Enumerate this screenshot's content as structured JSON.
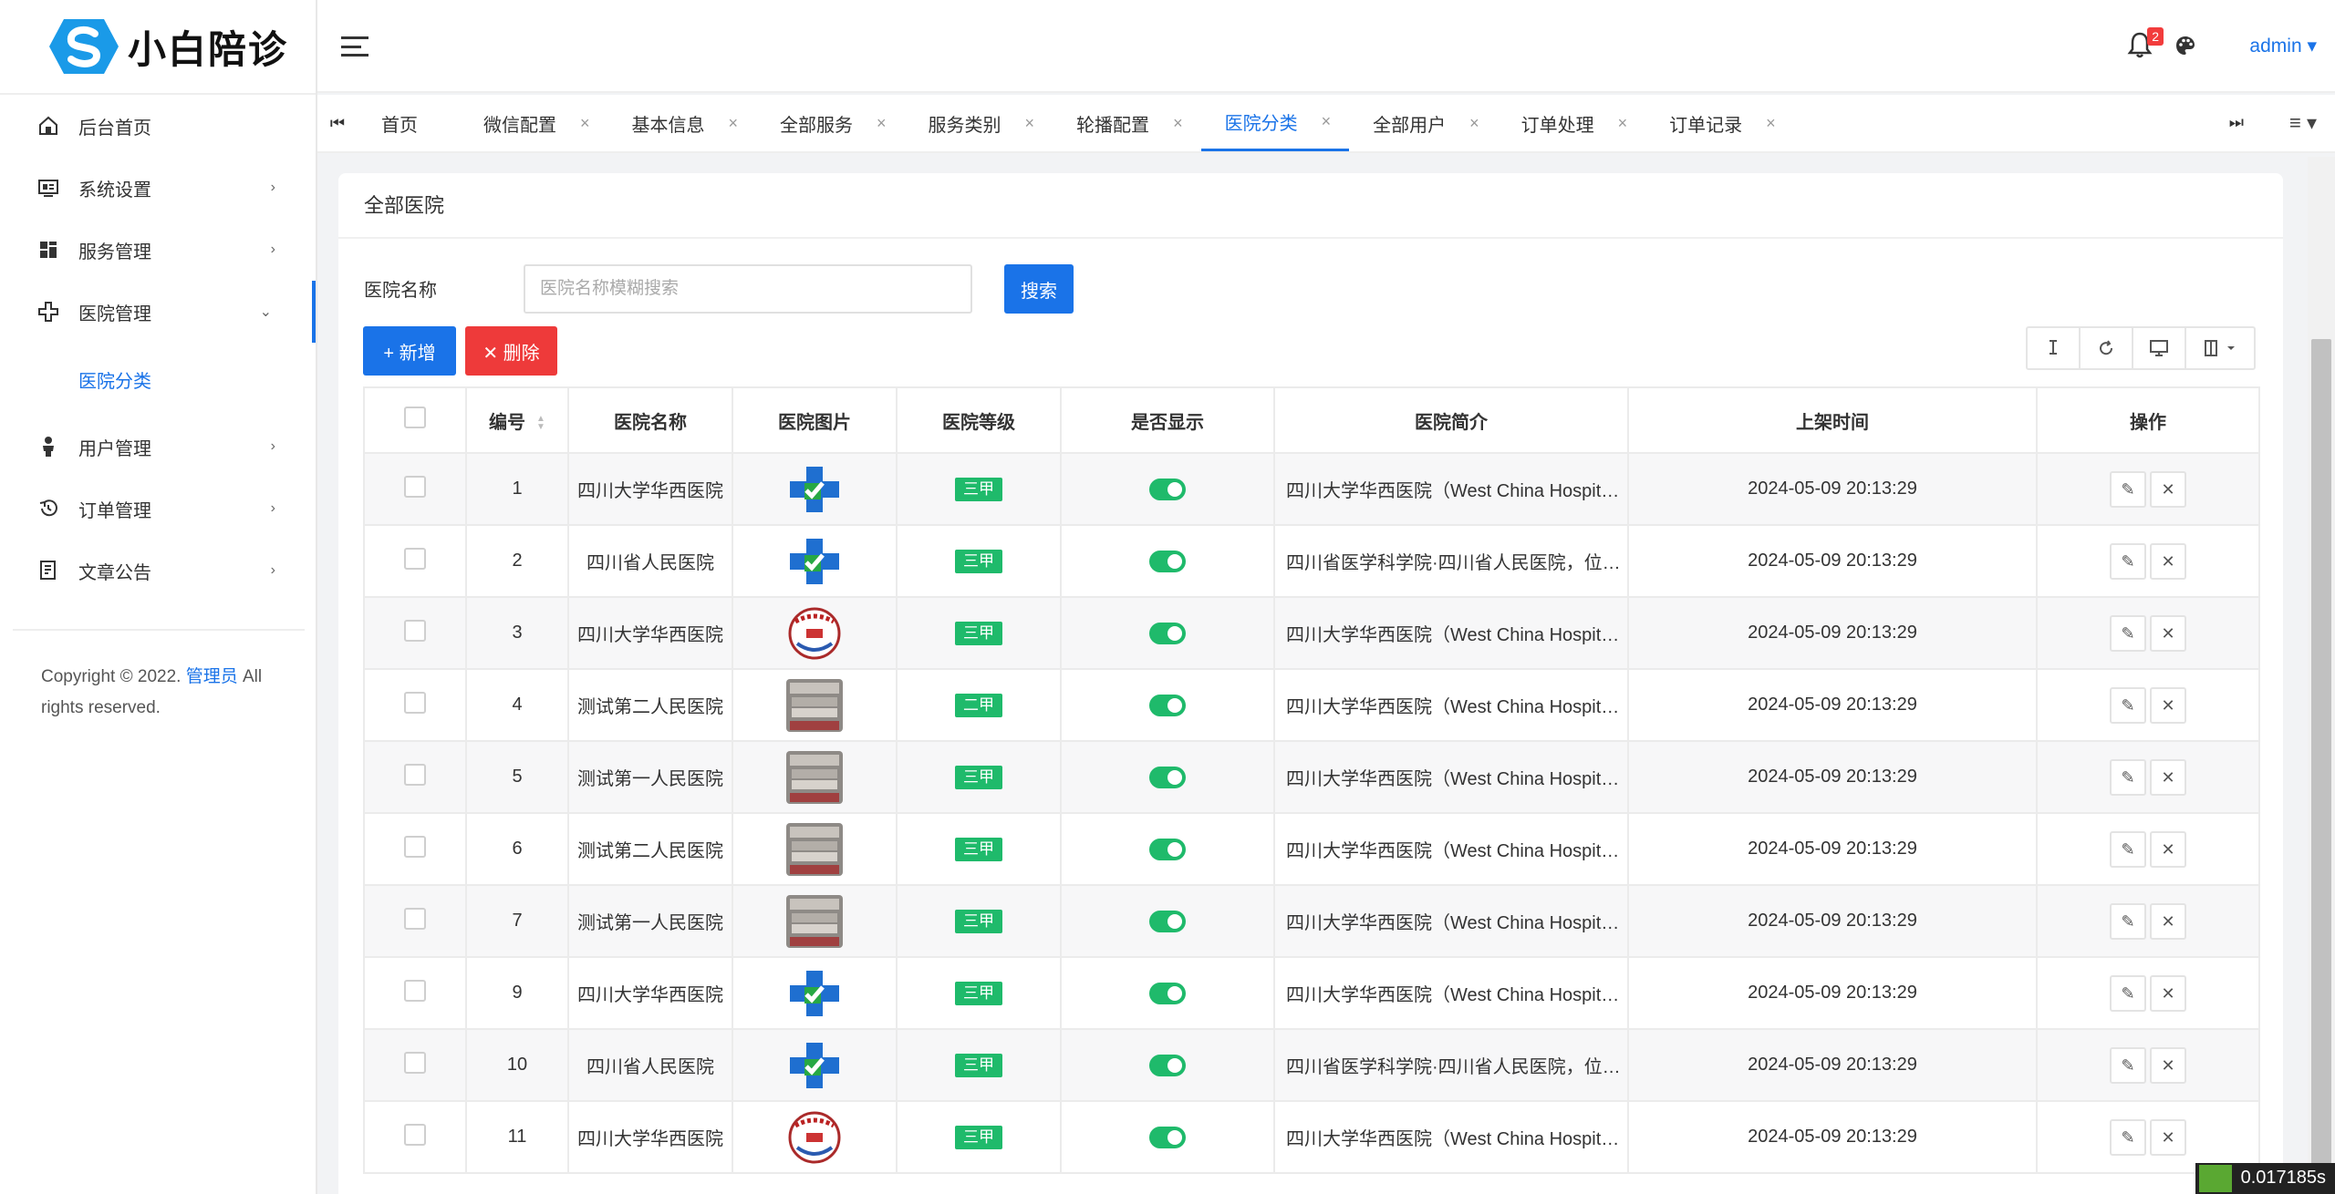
{
  "app": {
    "name": "小白陪诊"
  },
  "sidebar": {
    "items": [
      {
        "label": "后台首页",
        "icon": "home-icon",
        "arrow": ""
      },
      {
        "label": "系统设置",
        "icon": "settings-panel-icon",
        "arrow": "›"
      },
      {
        "label": "服务管理",
        "icon": "grid-icon",
        "arrow": "›"
      },
      {
        "label": "医院管理",
        "icon": "medical-cross-icon",
        "arrow": "⌄"
      },
      {
        "label": "用户管理",
        "icon": "user-icon",
        "arrow": "›"
      },
      {
        "label": "订单管理",
        "icon": "history-icon",
        "arrow": "›"
      },
      {
        "label": "文章公告",
        "icon": "document-icon",
        "arrow": "›"
      }
    ],
    "submenu": {
      "label": "医院分类"
    },
    "copyright": {
      "prefix": "Copyright © 2022. ",
      "link": "管理员",
      "suffix": " All rights reserved."
    }
  },
  "header": {
    "badge": "2",
    "user": "admin ▾"
  },
  "tabs": [
    {
      "label": "首页",
      "close": ""
    },
    {
      "label": "微信配置",
      "close": "×"
    },
    {
      "label": "基本信息",
      "close": "×"
    },
    {
      "label": "全部服务",
      "close": "×"
    },
    {
      "label": "服务类别",
      "close": "×"
    },
    {
      "label": "轮播配置",
      "close": "×"
    },
    {
      "label": "医院分类",
      "close": "×"
    },
    {
      "label": "全部用户",
      "close": "×"
    },
    {
      "label": "订单处理",
      "close": "×"
    },
    {
      "label": "订单记录",
      "close": "×"
    }
  ],
  "active_tab": "医院分类",
  "card": {
    "title": "全部医院",
    "search_label": "医院名称",
    "search_placeholder": "医院名称模糊搜索",
    "search_button": "搜索",
    "add_button": "+ 新增",
    "delete_button": "✕ 删除"
  },
  "table": {
    "headers": [
      "编号",
      "医院名称",
      "医院图片",
      "医院等级",
      "是否显示",
      "医院简介",
      "上架时间",
      "操作"
    ],
    "rows": [
      {
        "id": "1",
        "name": "四川大学华西医院",
        "image": "cross-logo",
        "grade": "三甲",
        "intro": "四川大学华西医院（West China Hospital of Sichuan University）",
        "time": "2024-05-09 20:13:29"
      },
      {
        "id": "2",
        "name": "四川省人民医院",
        "image": "cross-logo",
        "grade": "三甲",
        "intro": "四川省医学科学院·四川省人民医院，位于成都市",
        "time": "2024-05-09 20:13:29"
      },
      {
        "id": "3",
        "name": "四川大学华西医院",
        "image": "round-seal",
        "grade": "三甲",
        "intro": "四川大学华西医院（West China Hospital of Sichuan University）",
        "time": "2024-05-09 20:13:29"
      },
      {
        "id": "4",
        "name": "测试第二人民医院",
        "image": "building-photo",
        "grade": "二甲",
        "intro": "四川大学华西医院（West China Hospital of Sichuan University）",
        "time": "2024-05-09 20:13:29"
      },
      {
        "id": "5",
        "name": "测试第一人民医院",
        "image": "building-photo",
        "grade": "三甲",
        "intro": "四川大学华西医院（West China Hospital of Sichuan University）",
        "time": "2024-05-09 20:13:29"
      },
      {
        "id": "6",
        "name": "测试第二人民医院",
        "image": "building-photo",
        "grade": "三甲",
        "intro": "四川大学华西医院（West China Hospital of Sichuan University）",
        "time": "2024-05-09 20:13:29"
      },
      {
        "id": "7",
        "name": "测试第一人民医院",
        "image": "building-photo",
        "grade": "三甲",
        "intro": "四川大学华西医院（West China Hospital of Sichuan University）",
        "time": "2024-05-09 20:13:29"
      },
      {
        "id": "9",
        "name": "四川大学华西医院",
        "image": "cross-logo",
        "grade": "三甲",
        "intro": "四川大学华西医院（West China Hospital of Sichuan University）",
        "time": "2024-05-09 20:13:29"
      },
      {
        "id": "10",
        "name": "四川省人民医院",
        "image": "cross-logo",
        "grade": "三甲",
        "intro": "四川省医学科学院·四川省人民医院，位于成都市",
        "time": "2024-05-09 20:13:29"
      },
      {
        "id": "11",
        "name": "四川大学华西医院",
        "image": "round-seal",
        "grade": "三甲",
        "intro": "四川大学华西医院（West China Hospital of Sichuan University）",
        "time": "2024-05-09 20:13:29"
      }
    ]
  },
  "timer": "0.017185s",
  "colors": {
    "primary": "#1a73e8",
    "danger": "#ee3a3a",
    "success": "#1fba6b"
  }
}
